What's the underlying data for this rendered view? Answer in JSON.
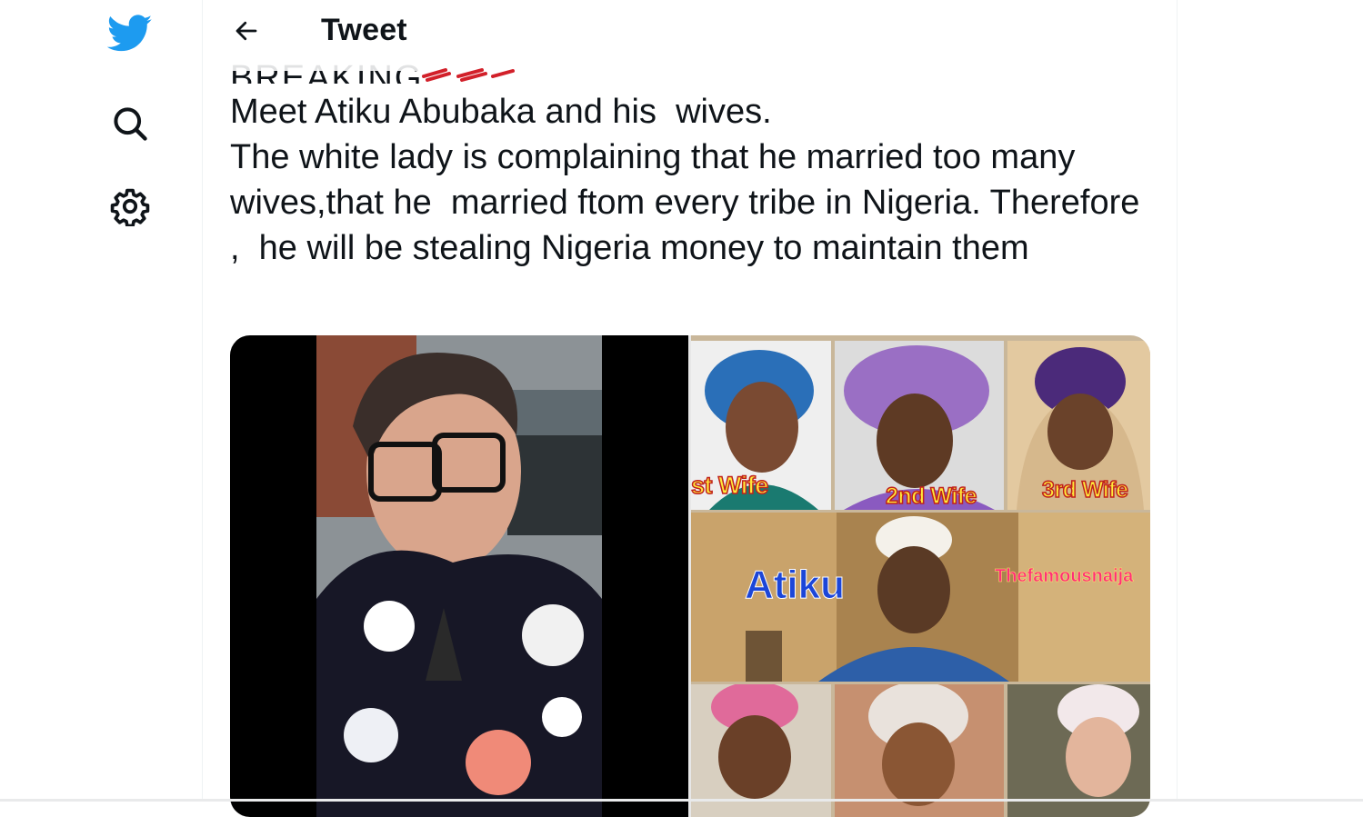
{
  "header": {
    "title": "Tweet"
  },
  "tweet": {
    "cutoff_text": "BREAKING",
    "text": "Meet Atiku Abubaka and his  wives.\nThe white lady is complaining that he married too many wives,that he  married ftom every tribe in Nigeria. Therefore ,  he will be stealing Nigeria money to maintain them"
  },
  "media": {
    "labels": {
      "first_wife": "st Wife",
      "second_wife": "2nd Wife",
      "third_wife": "3rd Wife",
      "atiku": "Atiku",
      "brand": "Thefamousnaija"
    }
  },
  "colors": {
    "twitter_blue": "#1d9bf0",
    "text": "#0f1419",
    "border": "#eff3f4"
  },
  "icons": [
    "twitter-logo-icon",
    "search-icon",
    "gear-icon",
    "back-arrow-icon"
  ]
}
